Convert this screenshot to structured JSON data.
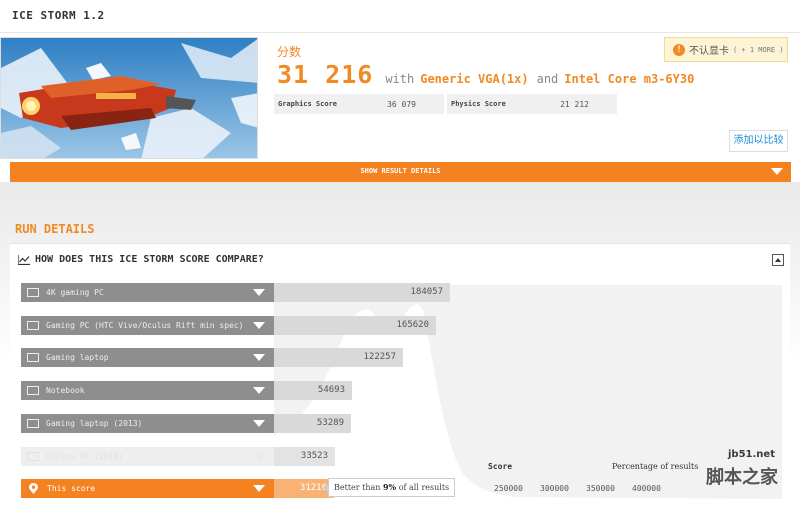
{
  "app": {
    "title": "ICE STORM 1.2"
  },
  "result": {
    "score_label": "分数",
    "score": "31 216",
    "with_text": "with",
    "gpu": "Generic VGA(1x)",
    "and_text": "and",
    "cpu": "Intel Core m3-6Y30",
    "subscores": [
      {
        "label": "Graphics Score",
        "value": "36 079"
      },
      {
        "label": "Physics Score",
        "value": "21 212"
      }
    ],
    "warning": {
      "icon": "exclamation-icon",
      "label": "不认显卡",
      "more": "( + 1 MORE )"
    },
    "compare_button": "添加以比较"
  },
  "show_details": "SHOW RESULT DETAILS",
  "run_details": "RUN DETAILS",
  "compare": {
    "title": "HOW DOES THIS ICE STORM SCORE COMPARE?",
    "rows": [
      {
        "label": "4K gaming PC",
        "value": "184057",
        "score": 184057,
        "icon": "monitor-icon",
        "state": "normal"
      },
      {
        "label": "Gaming PC (HTC Vive/Oculus Rift min spec)",
        "value": "165620",
        "score": 165620,
        "icon": "monitor-icon",
        "state": "normal"
      },
      {
        "label": "Gaming laptop",
        "value": "122257",
        "score": 122257,
        "icon": "laptop-icon",
        "state": "normal"
      },
      {
        "label": "Notebook",
        "value": "54693",
        "score": 54693,
        "icon": "laptop-icon",
        "state": "normal"
      },
      {
        "label": "Gaming laptop (2013)",
        "value": "53289",
        "score": 53289,
        "icon": "laptop-icon",
        "state": "normal"
      },
      {
        "label": "Office PC (2013)",
        "value": "33523",
        "score": 33523,
        "icon": "monitor-icon",
        "state": "dim"
      },
      {
        "label": "This score",
        "value": "31216",
        "score": 31216,
        "icon": "pin-icon",
        "state": "mine"
      }
    ],
    "callout": {
      "prefix": "Better than ",
      "percent": "9%",
      "suffix": " of all results"
    },
    "axis_title": "Score",
    "percentage_label": "Percentage of results",
    "ticks": [
      "250000",
      "300000",
      "350000",
      "400000"
    ]
  },
  "watermark": {
    "url": "jb51.net",
    "text": "脚本之家"
  },
  "colors": {
    "accent": "#f58220",
    "score_text": "#f08a24",
    "link": "#1a8cd8"
  }
}
